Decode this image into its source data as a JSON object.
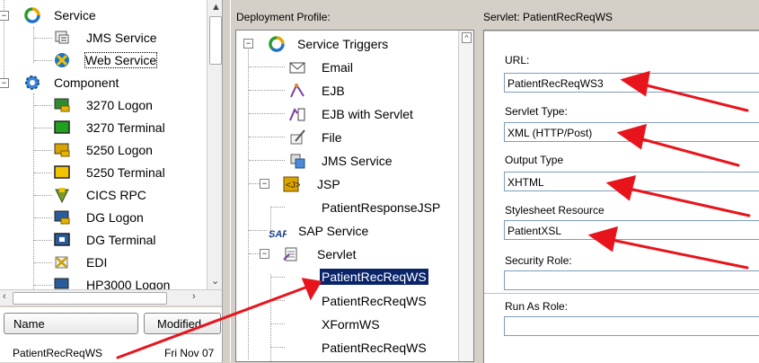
{
  "left_tree": {
    "items": [
      {
        "label": "Service",
        "icon": "service-cycle-icon"
      },
      {
        "label": "JMS Service",
        "icon": "jms-service-icon"
      },
      {
        "label": "Web Service",
        "icon": "web-service-icon"
      },
      {
        "label": "Component",
        "icon": "component-gear-icon"
      },
      {
        "label": "3270 Logon",
        "icon": "terminal-logon-icon"
      },
      {
        "label": "3270 Terminal",
        "icon": "terminal-green-icon"
      },
      {
        "label": "5250 Logon",
        "icon": "terminal-logon-icon"
      },
      {
        "label": "5250 Terminal",
        "icon": "terminal-yellow-icon"
      },
      {
        "label": "CICS RPC",
        "icon": "cics-rpc-icon"
      },
      {
        "label": "DG Logon",
        "icon": "dg-logon-icon"
      },
      {
        "label": "DG Terminal",
        "icon": "dg-terminal-icon"
      },
      {
        "label": "EDI",
        "icon": "edi-icon"
      },
      {
        "label": "HP3000 Logon",
        "icon": "hp3000-logon-icon"
      }
    ]
  },
  "file_table": {
    "columns": [
      "Name",
      "Modified"
    ],
    "rows": [
      [
        "PatientRecReqWS",
        "Fri Nov 07"
      ]
    ]
  },
  "middle": {
    "header": "Deployment Profile:",
    "items": [
      {
        "label": "Service Triggers",
        "icon": "service-cycle-icon"
      },
      {
        "label": "Email",
        "icon": "email-envelope-icon"
      },
      {
        "label": "EJB",
        "icon": "ejb-icon"
      },
      {
        "label": "EJB with Servlet",
        "icon": "ejb-servlet-icon"
      },
      {
        "label": "File",
        "icon": "file-quill-icon"
      },
      {
        "label": "JMS Service",
        "icon": "jms-service-icon"
      },
      {
        "label": "JSP",
        "icon": "jsp-icon"
      },
      {
        "label": "PatientResponseJSP",
        "icon": ""
      },
      {
        "label": "SAP Service",
        "icon": "sap-icon"
      },
      {
        "label": "Servlet",
        "icon": "servlet-icon"
      },
      {
        "label": "PatientRecReqWS",
        "icon": ""
      },
      {
        "label": "PatientRecReqWS",
        "icon": ""
      },
      {
        "label": "XFormWS",
        "icon": ""
      },
      {
        "label": "PatientRecReqWS",
        "icon": ""
      }
    ]
  },
  "right": {
    "header": "Servlet: PatientRecReqWS",
    "fields": [
      {
        "label": "URL:",
        "value": "PatientRecReqWS3"
      },
      {
        "label": "Servlet Type:",
        "value": "XML (HTTP/Post)"
      },
      {
        "label": "Output Type",
        "value": "XHTML"
      },
      {
        "label": "Stylesheet Resource",
        "value": "PatientXSL"
      },
      {
        "label": "Security Role:",
        "value": ""
      },
      {
        "label": "Run As Role:",
        "value": ""
      }
    ]
  },
  "colors": {
    "selection": "#0a246a",
    "annotation_arrow": "#e8141c",
    "panel_bg": "#d4d0c8"
  }
}
